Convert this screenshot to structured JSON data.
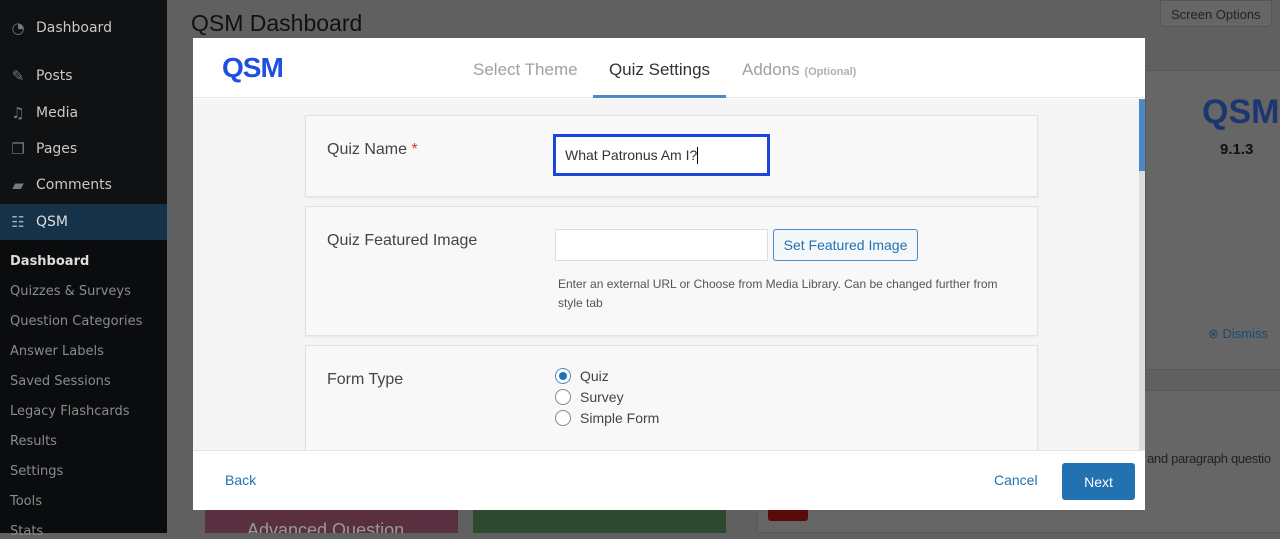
{
  "sidebar": {
    "menu": [
      {
        "label": "Dashboard",
        "icon": "dashboard-icon"
      },
      {
        "label": "Posts",
        "icon": "pin-icon"
      },
      {
        "label": "Media",
        "icon": "media-icon"
      },
      {
        "label": "Pages",
        "icon": "pages-icon"
      },
      {
        "label": "Comments",
        "icon": "comment-icon"
      },
      {
        "label": "QSM",
        "icon": "qsm-icon"
      }
    ],
    "submenu": [
      "Dashboard",
      "Quizzes & Surveys",
      "Question Categories",
      "Answer Labels",
      "Saved Sessions",
      "Legacy Flashcards",
      "Results",
      "Settings",
      "Tools",
      "Stats"
    ]
  },
  "background": {
    "page_title": "QSM Dashboard",
    "screen_options": "Screen Options",
    "logo": "QSM",
    "version": "9.1.3",
    "dismiss": "Dismiss",
    "snippet": "and paragraph questio",
    "card_title": "Advanced Question"
  },
  "modal": {
    "logo": "QSM",
    "tabs": [
      {
        "label": "Select Theme"
      },
      {
        "label": "Quiz Settings",
        "active": true
      },
      {
        "label": "Addons",
        "suffix": "(Optional)"
      }
    ],
    "quiz_name": {
      "label": "Quiz Name",
      "required": "*",
      "value": "What Patronus Am I?"
    },
    "featured_image": {
      "label": "Quiz Featured Image",
      "value": "",
      "button": "Set Featured Image",
      "help": "Enter an external URL or Choose from Media Library. Can be changed further from style tab"
    },
    "form_type": {
      "label": "Form Type",
      "options": [
        "Quiz",
        "Survey",
        "Simple Form"
      ],
      "selected": "Quiz"
    },
    "footer": {
      "back": "Back",
      "cancel": "Cancel",
      "next": "Next"
    }
  },
  "colors": {
    "accent": "#2271b1",
    "focus": "#1f44d8",
    "logo": "#1f4fe0"
  }
}
